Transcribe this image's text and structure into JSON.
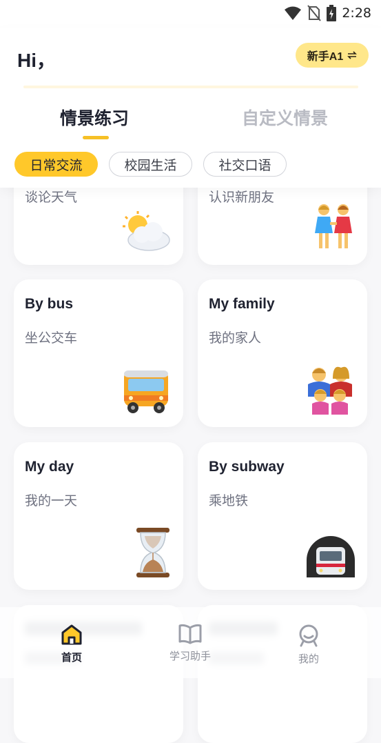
{
  "status_bar": {
    "time": "2:28",
    "icons": [
      "wifi-icon",
      "no-sim-icon",
      "battery-charging-icon"
    ]
  },
  "header": {
    "greeting": "Hi，",
    "level_badge": "新手A1",
    "level_switch_icon": "swap-arrows-icon"
  },
  "tabs": [
    {
      "label": "情景练习",
      "active": true
    },
    {
      "label": "自定义情景",
      "active": false
    }
  ],
  "categories": [
    {
      "label": "日常交流",
      "active": true
    },
    {
      "label": "校园生活",
      "active": false
    },
    {
      "label": "社交口语",
      "active": false
    }
  ],
  "cards": [
    {
      "title": "",
      "subtitle": "谈论天气",
      "icon": "sun-behind-cloud-icon"
    },
    {
      "title": "",
      "subtitle": "认识新朋友",
      "icon": "two-women-holding-hands-icon"
    },
    {
      "title": "By bus",
      "subtitle": "坐公交车",
      "icon": "bus-icon"
    },
    {
      "title": "My family",
      "subtitle": "我的家人",
      "icon": "family-icon"
    },
    {
      "title": "My day",
      "subtitle": "我的一天",
      "icon": "hourglass-icon"
    },
    {
      "title": "By subway",
      "subtitle": "乘地铁",
      "icon": "metro-icon"
    }
  ],
  "bottom_nav": [
    {
      "label": "首页",
      "icon": "home-icon",
      "active": true
    },
    {
      "label": "学习助手",
      "icon": "book-icon",
      "active": false
    },
    {
      "label": "我的",
      "icon": "profile-icon",
      "active": false
    }
  ],
  "colors": {
    "accent": "#ffc82a",
    "badge_bg": "#ffe78a",
    "text_primary": "#1f2230",
    "text_muted": "#b9bbc3"
  }
}
